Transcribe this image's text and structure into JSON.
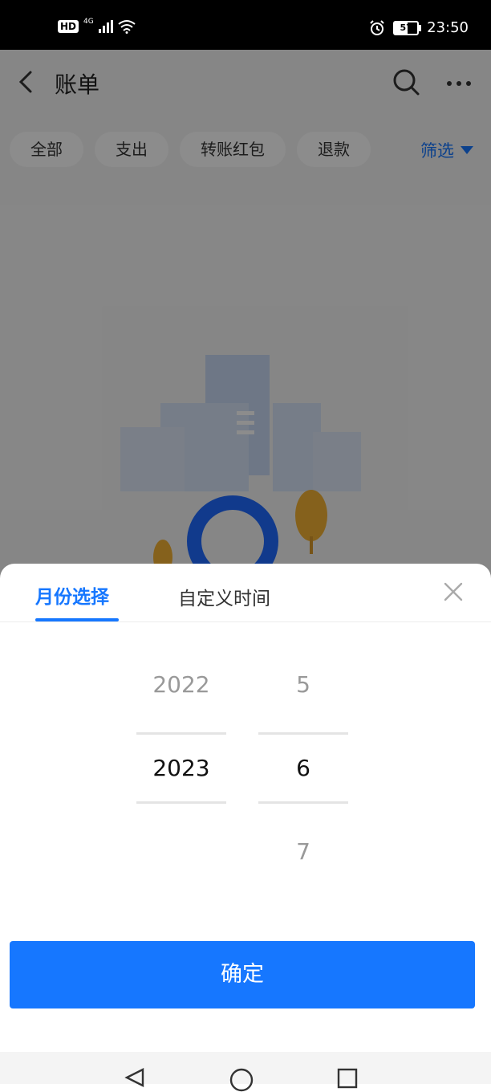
{
  "status_bar": {
    "hd": "HD",
    "network": "4G",
    "battery": "57",
    "time": "23:50"
  },
  "header": {
    "title": "账单"
  },
  "filters": {
    "chips": [
      "全部",
      "支出",
      "转账红包",
      "退款"
    ],
    "filter_label": "筛选"
  },
  "sheet": {
    "tabs": [
      "月份选择",
      "自定义时间"
    ],
    "year": {
      "prev": "2022",
      "selected": "2023",
      "next": ""
    },
    "month": {
      "prev": "5",
      "selected": "6",
      "next": "7"
    },
    "confirm_label": "确定"
  },
  "colors": {
    "accent": "#1677ff"
  }
}
